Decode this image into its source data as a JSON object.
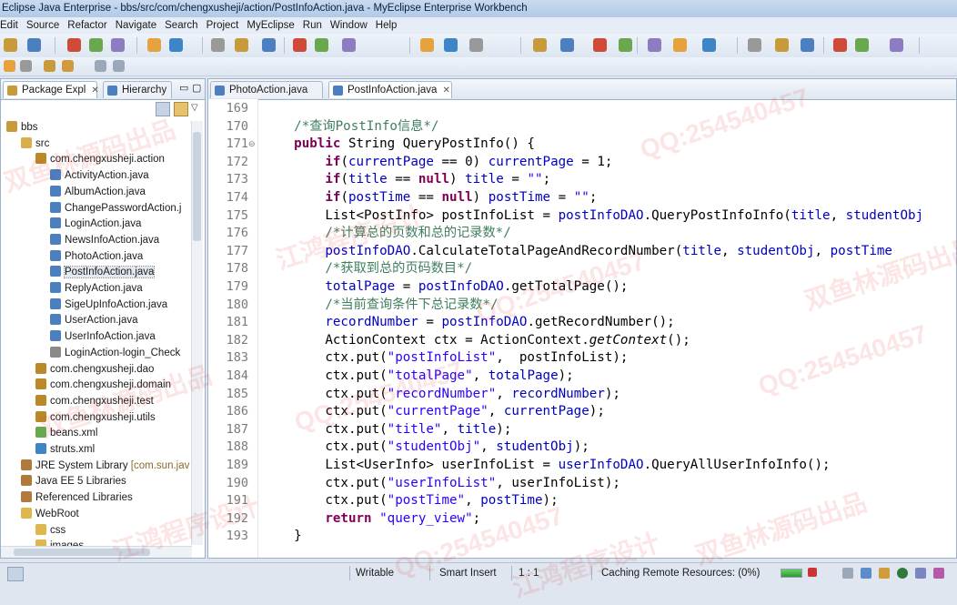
{
  "window": {
    "title": "Eclipse Java Enterprise - bbs/src/com/chengxusheji/action/PostInfoAction.java - MyEclipse Enterprise Workbench"
  },
  "menu": [
    "Edit",
    "Source",
    "Refactor",
    "Navigate",
    "Search",
    "Project",
    "MyEclipse",
    "Run",
    "Window",
    "Help"
  ],
  "left_tabs": {
    "package": "Package Expl",
    "hierarchy": "Hierarchy"
  },
  "tree": [
    {
      "label": "bbs",
      "icon": "project-icon",
      "indent": 0
    },
    {
      "label": "src",
      "icon": "source-folder-icon",
      "indent": 1
    },
    {
      "label": "com.chengxusheji.action",
      "icon": "package-icon",
      "indent": 2
    },
    {
      "label": "ActivityAction.java",
      "icon": "java-file-icon",
      "indent": 3
    },
    {
      "label": "AlbumAction.java",
      "icon": "java-file-icon",
      "indent": 3
    },
    {
      "label": "ChangePasswordAction.j",
      "icon": "java-file-icon",
      "indent": 3
    },
    {
      "label": "LoginAction.java",
      "icon": "java-file-icon",
      "indent": 3
    },
    {
      "label": "NewsInfoAction.java",
      "icon": "java-file-icon",
      "indent": 3
    },
    {
      "label": "PhotoAction.java",
      "icon": "java-file-icon",
      "indent": 3
    },
    {
      "label": "PostInfoAction.java",
      "icon": "java-file-icon",
      "indent": 3,
      "selected": true
    },
    {
      "label": "ReplyAction.java",
      "icon": "java-file-icon",
      "indent": 3
    },
    {
      "label": "SigeUpInfoAction.java",
      "icon": "java-file-icon",
      "indent": 3
    },
    {
      "label": "UserAction.java",
      "icon": "java-file-icon",
      "indent": 3
    },
    {
      "label": "UserInfoAction.java",
      "icon": "java-file-icon",
      "indent": 3
    },
    {
      "label": "LoginAction-login_Check",
      "icon": "xml-file-icon",
      "indent": 3
    },
    {
      "label": "com.chengxusheji.dao",
      "icon": "package-icon",
      "indent": 2
    },
    {
      "label": "com.chengxusheji.domain",
      "icon": "package-icon",
      "indent": 2
    },
    {
      "label": "com.chengxusheji.test",
      "icon": "package-icon",
      "indent": 2
    },
    {
      "label": "com.chengxusheji.utils",
      "icon": "package-icon",
      "indent": 2
    },
    {
      "label": "beans.xml",
      "icon": "beans-xml-icon",
      "indent": 2
    },
    {
      "label": "struts.xml",
      "icon": "gear-icon",
      "indent": 2
    },
    {
      "label": "JRE System Library",
      "suffix": " [com.sun.jav",
      "icon": "library-icon",
      "indent": 1
    },
    {
      "label": "Java EE 5 Libraries",
      "icon": "library-icon",
      "indent": 1
    },
    {
      "label": "Referenced Libraries",
      "icon": "library-icon",
      "indent": 1
    },
    {
      "label": "WebRoot",
      "icon": "folder-icon",
      "indent": 1
    },
    {
      "label": "css",
      "icon": "folder-icon",
      "indent": 2
    },
    {
      "label": "images",
      "icon": "folder-icon",
      "indent": 2
    }
  ],
  "editor_tabs": [
    {
      "label": "PhotoAction.java",
      "active": false
    },
    {
      "label": "PostInfoAction.java",
      "active": true
    }
  ],
  "code_lines": [
    {
      "n": "169",
      "t": []
    },
    {
      "n": "170",
      "t": [
        [
          "    ",
          ""
        ],
        [
          "/*查询PostInfo信息*/",
          "cmt"
        ]
      ]
    },
    {
      "n": "171",
      "fold": "⊖",
      "t": [
        [
          "    ",
          ""
        ],
        [
          "public",
          "kw"
        ],
        [
          " String QueryPostInfo() {",
          ""
        ]
      ]
    },
    {
      "n": "172",
      "t": [
        [
          "        ",
          ""
        ],
        [
          "if",
          "kw"
        ],
        [
          "(",
          ""
        ],
        [
          "currentPage",
          "fld"
        ],
        [
          " == 0) ",
          ""
        ],
        [
          "currentPage",
          "fld"
        ],
        [
          " = 1;",
          ""
        ]
      ]
    },
    {
      "n": "173",
      "t": [
        [
          "        ",
          ""
        ],
        [
          "if",
          "kw"
        ],
        [
          "(",
          ""
        ],
        [
          "title",
          "fld"
        ],
        [
          " == ",
          ""
        ],
        [
          "null",
          "kw"
        ],
        [
          ") ",
          ""
        ],
        [
          "title",
          "fld"
        ],
        [
          " = ",
          ""
        ],
        [
          "\"\"",
          "str"
        ],
        [
          ";",
          ""
        ]
      ]
    },
    {
      "n": "174",
      "t": [
        [
          "        ",
          ""
        ],
        [
          "if",
          "kw"
        ],
        [
          "(",
          ""
        ],
        [
          "postTime",
          "fld"
        ],
        [
          " == ",
          ""
        ],
        [
          "null",
          "kw"
        ],
        [
          ") ",
          ""
        ],
        [
          "postTime",
          "fld"
        ],
        [
          " = ",
          ""
        ],
        [
          "\"\"",
          "str"
        ],
        [
          ";",
          ""
        ]
      ]
    },
    {
      "n": "175",
      "t": [
        [
          "        List<PostInfo> postInfoList = ",
          ""
        ],
        [
          "postInfoDAO",
          "fld"
        ],
        [
          ".QueryPostInfoInfo(",
          ""
        ],
        [
          "title",
          "fld"
        ],
        [
          ", ",
          ""
        ],
        [
          "studentObj",
          "fld"
        ]
      ]
    },
    {
      "n": "176",
      "t": [
        [
          "        ",
          ""
        ],
        [
          "/*计算总的页数和总的记录数*/",
          "cmt"
        ]
      ]
    },
    {
      "n": "177",
      "t": [
        [
          "        ",
          ""
        ],
        [
          "postInfoDAO",
          "fld"
        ],
        [
          ".CalculateTotalPageAndRecordNumber(",
          ""
        ],
        [
          "title",
          "fld"
        ],
        [
          ", ",
          ""
        ],
        [
          "studentObj",
          "fld"
        ],
        [
          ", ",
          ""
        ],
        [
          "postTime",
          "fld"
        ]
      ]
    },
    {
      "n": "178",
      "t": [
        [
          "        ",
          ""
        ],
        [
          "/*获取到总的页码数目*/",
          "cmt"
        ]
      ]
    },
    {
      "n": "179",
      "t": [
        [
          "        ",
          ""
        ],
        [
          "totalPage",
          "fld"
        ],
        [
          " = ",
          ""
        ],
        [
          "postInfoDAO",
          "fld"
        ],
        [
          ".getTotalPage();",
          ""
        ]
      ]
    },
    {
      "n": "180",
      "t": [
        [
          "        ",
          ""
        ],
        [
          "/*当前查询条件下总记录数*/",
          "cmt"
        ]
      ]
    },
    {
      "n": "181",
      "t": [
        [
          "        ",
          ""
        ],
        [
          "recordNumber",
          "fld"
        ],
        [
          " = ",
          ""
        ],
        [
          "postInfoDAO",
          "fld"
        ],
        [
          ".getRecordNumber();",
          ""
        ]
      ]
    },
    {
      "n": "182",
      "t": [
        [
          "        ActionContext ctx = ActionContext.",
          ""
        ],
        [
          "getContext",
          "it"
        ],
        [
          "();",
          ""
        ]
      ]
    },
    {
      "n": "183",
      "t": [
        [
          "        ctx.put(",
          ""
        ],
        [
          "\"postInfoList\"",
          "str"
        ],
        [
          ",  postInfoList);",
          ""
        ]
      ]
    },
    {
      "n": "184",
      "t": [
        [
          "        ctx.put(",
          ""
        ],
        [
          "\"totalPage\"",
          "str"
        ],
        [
          ", ",
          ""
        ],
        [
          "totalPage",
          "fld"
        ],
        [
          ");",
          ""
        ]
      ]
    },
    {
      "n": "185",
      "t": [
        [
          "        ctx.put(",
          ""
        ],
        [
          "\"recordNumber\"",
          "str"
        ],
        [
          ", ",
          ""
        ],
        [
          "recordNumber",
          "fld"
        ],
        [
          ");",
          ""
        ]
      ]
    },
    {
      "n": "186",
      "t": [
        [
          "        ctx.put(",
          ""
        ],
        [
          "\"currentPage\"",
          "str"
        ],
        [
          ", ",
          ""
        ],
        [
          "currentPage",
          "fld"
        ],
        [
          ");",
          ""
        ]
      ]
    },
    {
      "n": "187",
      "t": [
        [
          "        ctx.put(",
          ""
        ],
        [
          "\"title\"",
          "str"
        ],
        [
          ", ",
          ""
        ],
        [
          "title",
          "fld"
        ],
        [
          ");",
          ""
        ]
      ]
    },
    {
      "n": "188",
      "t": [
        [
          "        ctx.put(",
          ""
        ],
        [
          "\"studentObj\"",
          "str"
        ],
        [
          ", ",
          ""
        ],
        [
          "studentObj",
          "fld"
        ],
        [
          ");",
          ""
        ]
      ]
    },
    {
      "n": "189",
      "t": [
        [
          "        List<UserInfo> userInfoList = ",
          ""
        ],
        [
          "userInfoDAO",
          "fld"
        ],
        [
          ".QueryAllUserInfoInfo();",
          ""
        ]
      ]
    },
    {
      "n": "190",
      "t": [
        [
          "        ctx.put(",
          ""
        ],
        [
          "\"userInfoList\"",
          "str"
        ],
        [
          ", userInfoList);",
          ""
        ]
      ]
    },
    {
      "n": "191",
      "t": [
        [
          "        ctx.put(",
          ""
        ],
        [
          "\"postTime\"",
          "str"
        ],
        [
          ", ",
          ""
        ],
        [
          "postTime",
          "fld"
        ],
        [
          ");",
          ""
        ]
      ]
    },
    {
      "n": "192",
      "t": [
        [
          "        ",
          ""
        ],
        [
          "return",
          "kw"
        ],
        [
          " ",
          ""
        ],
        [
          "\"query_view\"",
          "str"
        ],
        [
          ";",
          ""
        ]
      ]
    },
    {
      "n": "193",
      "t": [
        [
          "    }",
          ""
        ]
      ]
    }
  ],
  "status": {
    "writable": "Writable",
    "insert_mode": "Smart Insert",
    "position": "1 : 1",
    "task": "Caching Remote Resources: (0%)",
    "progress_fraction": 1.0
  },
  "watermarks": [
    "双鱼林源码出品",
    "QQ:254540457",
    "江鸿程序设计"
  ]
}
